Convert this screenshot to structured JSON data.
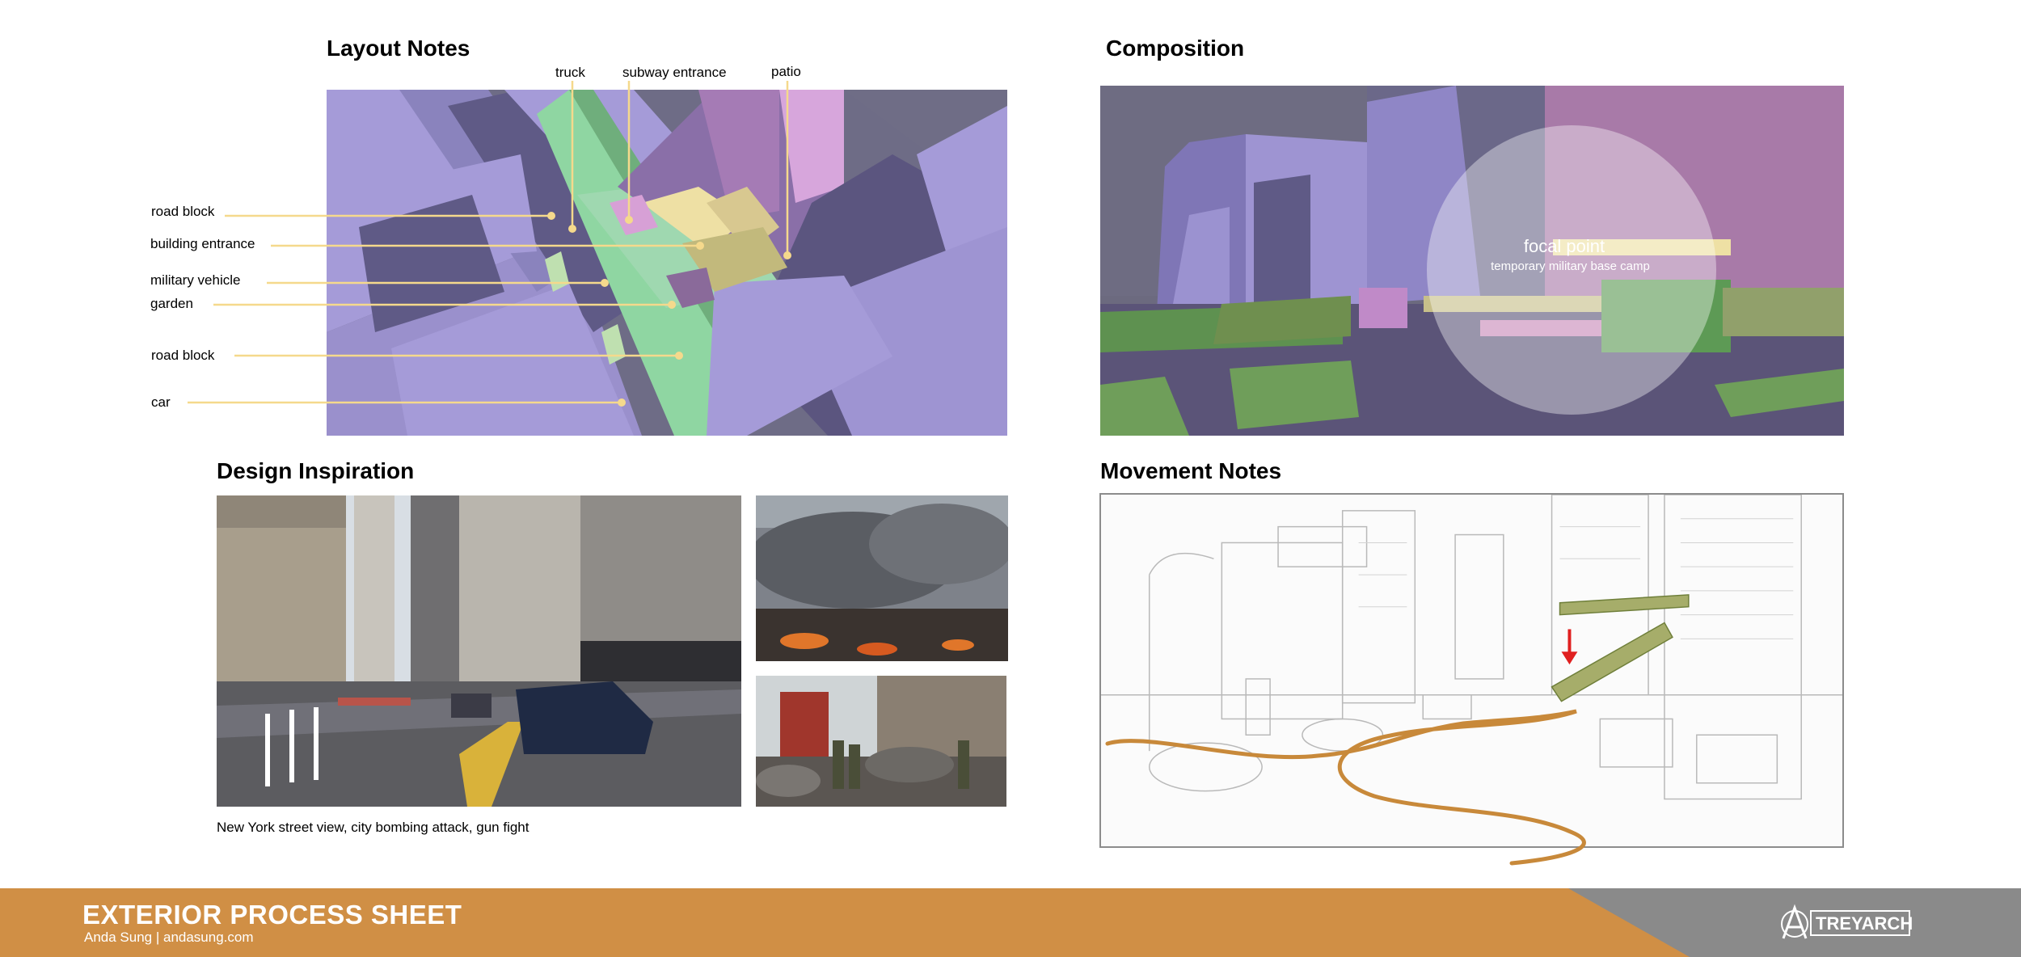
{
  "layout_notes": {
    "title": "Layout Notes",
    "labels": {
      "truck": "truck",
      "subway_entrance": "subway entrance",
      "patio": "patio",
      "road_block_1": "road block",
      "building_entrance": "building entrance",
      "military_vehicle": "military vehicle",
      "garden": "garden",
      "road_block_2": "road block",
      "car": "car"
    },
    "callout_color": "#f5d98c"
  },
  "composition": {
    "title": "Composition",
    "focal_point_title": "focal point",
    "focal_point_subtitle": "temporary military base camp"
  },
  "design_inspiration": {
    "title": "Design Inspiration",
    "caption": "New York street view, city bombing attack, gun fight"
  },
  "movement_notes": {
    "title": "Movement Notes",
    "path_color": "#c8893a",
    "arrow_color": "#e02020"
  },
  "footer": {
    "title": "EXTERIOR PROCESS SHEET",
    "subtitle": "Anda Sung | andasung.com",
    "logo_text": "TREYARCH",
    "band_color": "#d08f45",
    "grey_color": "#8a8a8a"
  },
  "palette": {
    "purple": "#a49ad6",
    "dark_purple": "#5d5684",
    "green": "#9fd6a6",
    "pink": "#d7a0d6",
    "olive": "#6f8f4f"
  }
}
